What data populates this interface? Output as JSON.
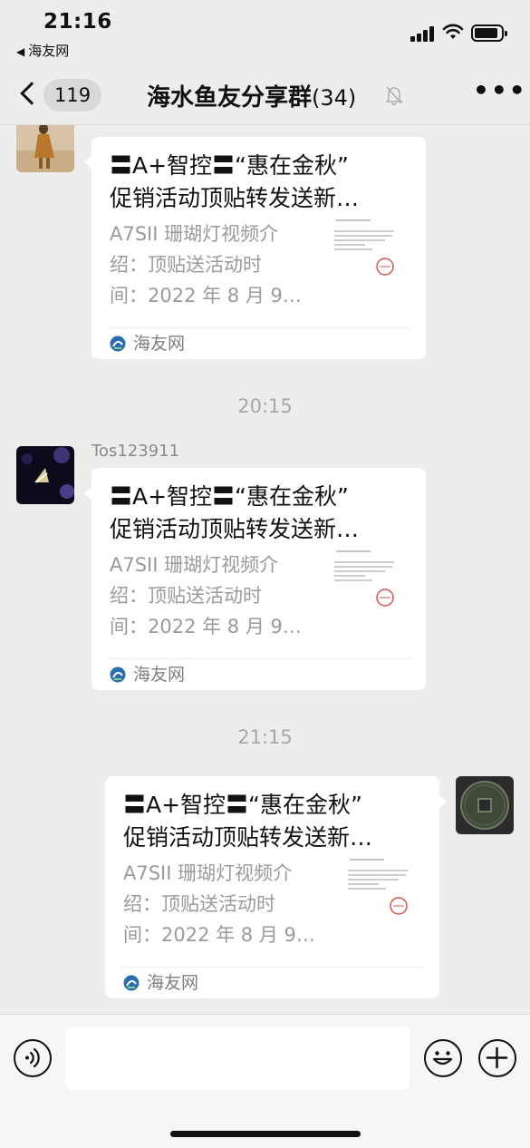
{
  "status_bar": {
    "time": "21:16",
    "back_app": "海友网"
  },
  "nav": {
    "unread_count": "119",
    "title": "海水鱼友分享群",
    "member_count": "(34)"
  },
  "timestamps": [
    "20:15",
    "21:15"
  ],
  "messages": [
    {
      "sender": "",
      "card": {
        "title_line1": "〓A+智控〓“惠在金秋”",
        "title_line2": "促销活动顶贴转发送新…",
        "desc_line1": "A7SII 珊瑚灯视频介",
        "desc_line2": "绍：顶贴送活动时",
        "desc_line3": "间：2022 年 8 月 9…",
        "source": "海友网"
      }
    },
    {
      "sender": "Tos123911",
      "card": {
        "title_line1": "〓A+智控〓“惠在金秋”",
        "title_line2": "促销活动顶贴转发送新…",
        "desc_line1": "A7SII 珊瑚灯视频介",
        "desc_line2": "绍：顶贴送活动时",
        "desc_line3": "间：2022 年 8 月 9…",
        "source": "海友网"
      }
    },
    {
      "sender": "",
      "card": {
        "title_line1": "〓A+智控〓“惠在金秋”",
        "title_line2": "促销活动顶贴转发送新…",
        "desc_line1": "A7SII 珊瑚灯视频介",
        "desc_line2": "绍：顶贴送活动时",
        "desc_line3": "间：2022 年 8 月 9…",
        "source": "海友网"
      }
    }
  ],
  "icons": {
    "back": "chevron-left-icon",
    "mute": "bell-slash-icon",
    "more": "more-dots-icon",
    "voice": "voice-icon",
    "emoji": "emoji-icon",
    "plus": "plus-icon",
    "source": "haiyou-logo-icon"
  },
  "colors": {
    "background": "#ededed",
    "bubble": "#ffffff",
    "muted_text": "#9a9a9a"
  }
}
